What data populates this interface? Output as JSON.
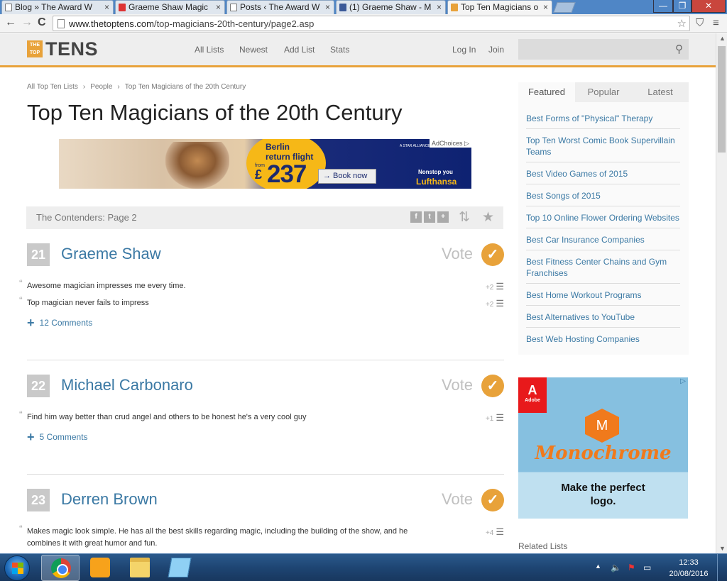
{
  "browser": {
    "tabs": [
      {
        "label": "Blog » The Award W",
        "icon": "page-icon"
      },
      {
        "label": "Graeme Shaw Magic",
        "icon": "youtube-icon"
      },
      {
        "label": "Posts ‹ The Award W",
        "icon": "page-icon"
      },
      {
        "label": "(1) Graeme Shaw - M",
        "icon": "facebook-icon"
      },
      {
        "label": "Top Ten Magicians o",
        "icon": "thetoptens-icon"
      }
    ],
    "tab_close": "×",
    "url_host": "www.thetoptens.com",
    "url_path": "/top-magicians-20th-century/page2.asp",
    "window_buttons": {
      "minimize": "—",
      "maximize": "❐",
      "close": "✕"
    },
    "nav": {
      "back": "←",
      "forward": "→",
      "reload": "C"
    }
  },
  "site": {
    "logo_small": "THE TOP",
    "logo_word": "TENS",
    "nav": [
      "All Lists",
      "Newest",
      "Add List",
      "Stats"
    ],
    "login": "Log In",
    "join": "Join",
    "accent": "#e8a23a",
    "link_color": "#3b79a4"
  },
  "breadcrumb": [
    "All Top Ten Lists",
    "People",
    "Top Ten Magicians of the 20th Century"
  ],
  "breadcrumb_sep": "›",
  "page_title": "Top Ten Magicians of the 20th Century",
  "ad_top": {
    "headline_1": "Berlin",
    "headline_2": "return flight",
    "from": "from",
    "currency": "£",
    "price": "237",
    "cta": "→ Book now",
    "adchoices": "AdChoices ▷",
    "alliance": "A STAR ALLIANCE MEMBER",
    "nonstop": "Nonstop you",
    "brand": "Lufthansa"
  },
  "contenders": {
    "label": "The Contenders: Page 2",
    "share": [
      "f",
      "t",
      "+"
    ]
  },
  "entries": [
    {
      "rank": "21",
      "name": "Graeme Shaw",
      "vote": "Vote",
      "comments": [
        {
          "text": "Awesome magician impresses me every time.",
          "score": "+2"
        },
        {
          "text": "Top magician never fails to impress",
          "score": "+2"
        }
      ],
      "more": "12 Comments"
    },
    {
      "rank": "22",
      "name": "Michael Carbonaro",
      "vote": "Vote",
      "comments": [
        {
          "text": "Find him way better than crud angel and others to be honest he's a very cool guy",
          "score": "+1"
        }
      ],
      "more": "5 Comments"
    },
    {
      "rank": "23",
      "name": "Derren Brown",
      "vote": "Vote",
      "comments": [
        {
          "text": "Makes magic look simple. He has all the best skills regarding magic, including the building of the show, and he combines it with great humor and fun.",
          "score": "+4"
        }
      ],
      "more": ""
    }
  ],
  "sidebar": {
    "tabs": [
      "Featured",
      "Popular",
      "Latest"
    ],
    "items": [
      "Best Forms of \"Physical\" Therapy",
      "Top Ten Worst Comic Book Supervillain Teams",
      "Best Video Games of 2015",
      "Best Songs of 2015",
      "Top 10 Online Flower Ordering Websites",
      "Best Car Insurance Companies",
      "Best Fitness Center Chains and Gym Franchises",
      "Best Home Workout Programs",
      "Best Alternatives to YouTube",
      "Best Web Hosting Companies"
    ]
  },
  "ad_side": {
    "adobe": "Adobe",
    "letter": "M",
    "brand": "Monochrome",
    "tagline": "Make the perfect logo."
  },
  "related_heading": "Related Lists",
  "taskbar": {
    "time": "12:33",
    "date": "20/08/2016"
  }
}
